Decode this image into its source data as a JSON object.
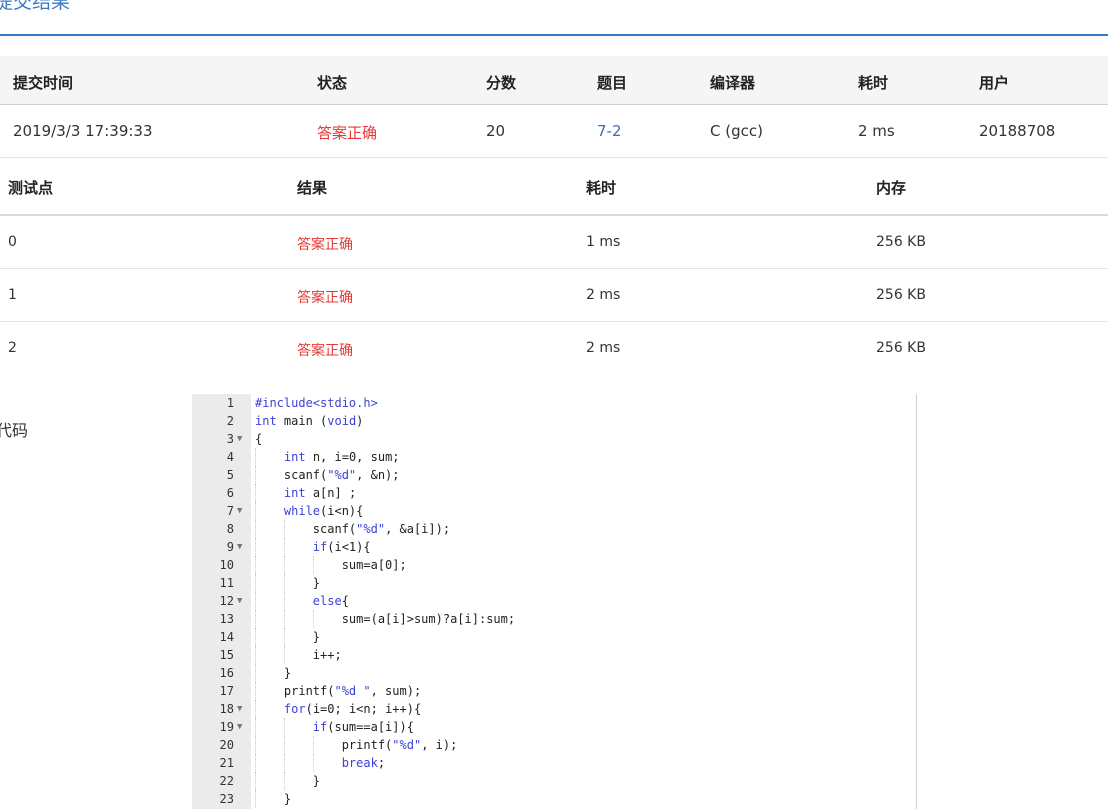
{
  "heading": "提交结果",
  "summary": {
    "headers": [
      "提交时间",
      "状态",
      "分数",
      "题目",
      "编译器",
      "耗时",
      "用户"
    ],
    "row": [
      "2019/3/3 17:39:33",
      "答案正确",
      "20",
      "7-2",
      "C (gcc)",
      "2 ms",
      "20188708"
    ]
  },
  "tests": {
    "headers": [
      "测试点",
      "结果",
      "耗时",
      "内存"
    ],
    "rows": [
      [
        "0",
        "答案正确",
        "1 ms",
        "256 KB"
      ],
      [
        "1",
        "答案正确",
        "2 ms",
        "256 KB"
      ],
      [
        "2",
        "答案正确",
        "2 ms",
        "256 KB"
      ]
    ]
  },
  "code_label": "代码",
  "code_lines": [
    "#include<stdio.h>",
    "int main (void)",
    "{",
    "    int n, i=0, sum;",
    "    scanf(\"%d\", &n);",
    "    int a[n] ;",
    "    while(i<n){",
    "        scanf(\"%d\", &a[i]);",
    "        if(i<1){",
    "            sum=a[0];",
    "        }",
    "        else{",
    "            sum=(a[i]>sum)?a[i]:sum;",
    "        }",
    "        i++;",
    "    }",
    "    printf(\"%d \", sum);",
    "    for(i=0; i<n; i++){",
    "        if(sum==a[i]){",
    "            printf(\"%d\", i);",
    "            break;",
    "        }",
    "    }"
  ],
  "foldable_lines": [
    3,
    7,
    9,
    12,
    18,
    19
  ],
  "colors": {
    "accent": "#3a78c2",
    "success": "#e53935",
    "link": "#3b6fb2"
  }
}
